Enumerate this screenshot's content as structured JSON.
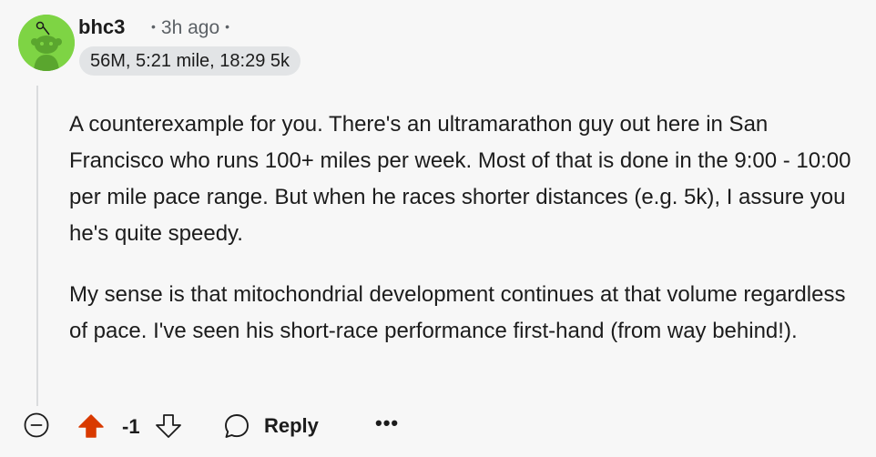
{
  "comment": {
    "username": "bhc3",
    "timestamp": "3h ago",
    "flair": "56M, 5:21 mile, 18:29 5k",
    "paragraphs": [
      "A counterexample for you. There's an ultramarathon guy out here in San Francisco who runs 100+ miles per week. Most of that is done in the 9:00 - 10:00 per mile pace range. But when he races shorter distances (e.g. 5k), I assure you he's quite speedy.",
      "My sense is that mitochondrial development continues at that volume regardless of pace. I've seen his short-race performance first-hand (from way behind!)."
    ]
  },
  "actions": {
    "score": "-1",
    "reply_label": "Reply",
    "more_label": "•••"
  },
  "colors": {
    "avatar_bg": "#7ed444",
    "upvote_active": "#d93a00",
    "text": "#1c1c1c",
    "meta": "#5c6166",
    "flair_bg": "#e2e4e6",
    "background": "#f7f7f7"
  },
  "icons": {
    "avatar": "reddit-snoo-avatar",
    "collapse": "minus-circle-icon",
    "upvote": "upvote-arrow-icon",
    "downvote": "downvote-arrow-icon",
    "reply": "speech-bubble-icon",
    "more": "ellipsis-icon"
  }
}
